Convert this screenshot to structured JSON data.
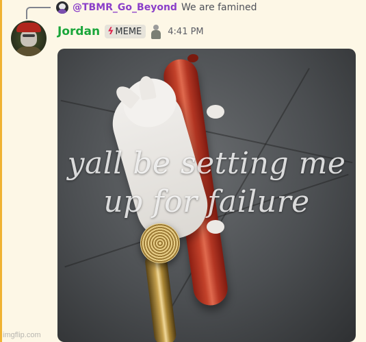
{
  "reply": {
    "username": "@TBMR_Go_Beyond",
    "text": "We are famined"
  },
  "message": {
    "username": "Jordan",
    "role_label": "MEME",
    "role_icon": "lightning-bolt-icon",
    "timestamp": "4:41 PM"
  },
  "attachment": {
    "caption_line1": "yall be setting me",
    "caption_line2": "up for failure"
  },
  "watermark": "imgflip.com",
  "colors": {
    "username": "#1aa63a",
    "reply_username": "#8b3fc9",
    "highlight_bar": "#f0b232",
    "background": "#fdf7e6"
  }
}
